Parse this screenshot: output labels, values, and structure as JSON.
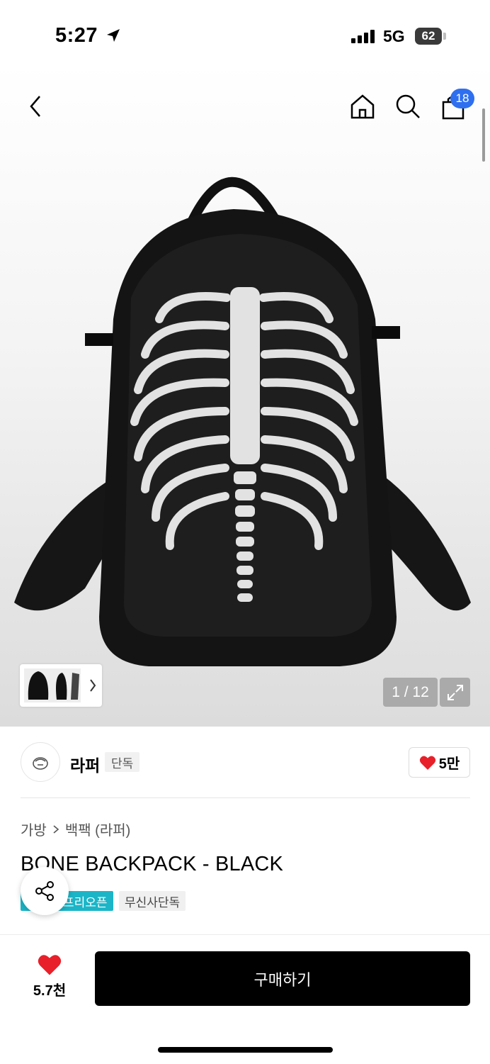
{
  "status_bar": {
    "time": "5:27",
    "network": "5G",
    "battery": "62"
  },
  "header": {
    "cart_count": "18",
    "icons": [
      "back-icon",
      "home-icon",
      "search-icon",
      "bag-icon"
    ]
  },
  "gallery": {
    "counter": "1 / 12",
    "thumbnail_count": 3
  },
  "brand": {
    "name": "라퍼",
    "tag": "단독",
    "likes": "5만"
  },
  "product": {
    "category": "가방",
    "subcategory": "백팩 (라퍼)",
    "title": "BONE BACKPACK - BLACK",
    "tags": [
      "프리오픈",
      "무신사단독"
    ]
  },
  "bottom_bar": {
    "wish_count": "5.7천",
    "buy_label": "구매하기"
  },
  "colors": {
    "accent_blue": "#2e6ff0",
    "tag_teal": "#1bb5c7",
    "heart_red": "#e8202a"
  }
}
